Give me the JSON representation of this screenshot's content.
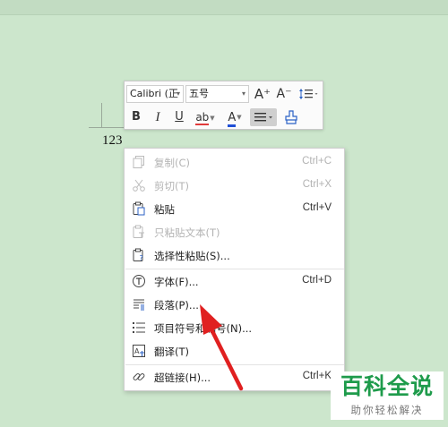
{
  "document": {
    "text": "123"
  },
  "mini_toolbar": {
    "font_name": "Calibri (正",
    "font_size": "五号",
    "grow_label": "A⁺",
    "shrink_label": "A⁻",
    "bold_label": "B",
    "italic_label": "I",
    "underline_label": "U",
    "highlight_label": "ab",
    "font_color_label": "A",
    "font_color_underline": "#1f4fd6",
    "highlight_underline": "#e03a3a"
  },
  "context_menu": {
    "items": [
      {
        "label": "复制(C)",
        "shortcut": "Ctrl+C",
        "enabled": false
      },
      {
        "label": "剪切(T)",
        "shortcut": "Ctrl+X",
        "enabled": false
      },
      {
        "label": "粘贴",
        "shortcut": "Ctrl+V",
        "enabled": true
      },
      {
        "label": "只粘贴文本(T)",
        "shortcut": "",
        "enabled": false
      },
      {
        "label": "选择性粘贴(S)...",
        "shortcut": "",
        "enabled": true
      },
      {
        "label": "字体(F)...",
        "shortcut": "Ctrl+D",
        "enabled": true
      },
      {
        "label": "段落(P)...",
        "shortcut": "",
        "enabled": true
      },
      {
        "label": "项目符号和编号(N)...",
        "shortcut": "",
        "enabled": true
      },
      {
        "label": "翻译(T)",
        "shortcut": "",
        "enabled": true
      },
      {
        "label": "超链接(H)...",
        "shortcut": "Ctrl+K",
        "enabled": true
      }
    ]
  },
  "watermark": {
    "title": "百科全说",
    "subtitle": "助你轻松解决"
  },
  "colors": {
    "arrow": "#e02020",
    "watermark_green": "#1e9b4b",
    "background": "#cce6cc"
  }
}
